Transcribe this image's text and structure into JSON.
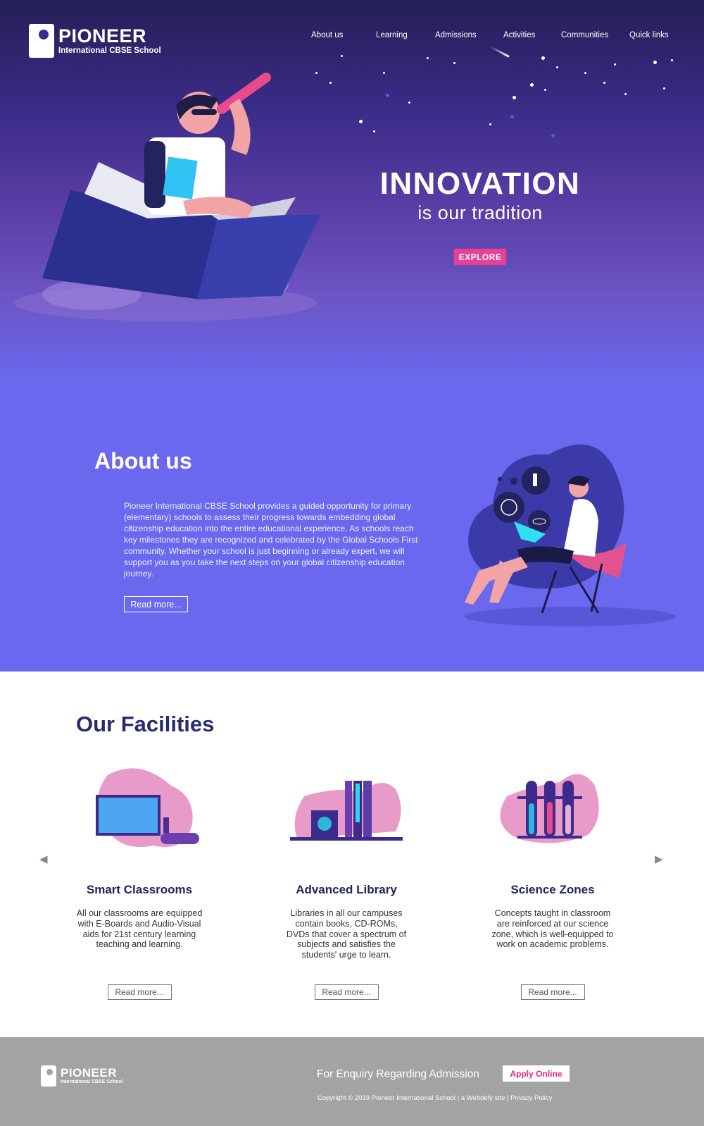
{
  "brand": {
    "name": "PIONEER",
    "subtitle": "International CBSE School"
  },
  "nav": {
    "items": [
      {
        "label": "About us"
      },
      {
        "label": "Learning"
      },
      {
        "label": "Admissions"
      },
      {
        "label": "Activities"
      },
      {
        "label": "Communities"
      },
      {
        "label": "Quick links"
      }
    ]
  },
  "hero": {
    "title": "INNOVATION",
    "subtitle": "is our tradition",
    "cta_label": "EXPLORE"
  },
  "about": {
    "title": "About us",
    "body": "Pioneer International CBSE School provides a guided opportunity for primary (elementary) schools to assess their progress towards embedding global citizenship education into the entire educational experience. As schools reach key milestones they are recognized and celebrated by the Global Schools First community. Whether your school is just beginning or already expert, we will support you as you take the next steps on your global citizenship education journey.",
    "read_more": "Read more..."
  },
  "facilities": {
    "title": "Our Facilities",
    "prev_icon": "◀",
    "next_icon": "▶",
    "cards": [
      {
        "title": "Smart Classrooms",
        "text": "All our classrooms are equipped with E-Boards and Audio-Visual aids for 21st century learning teaching and learning.",
        "read_more": "Read more...",
        "icon": "smart-board-icon"
      },
      {
        "title": "Advanced Library",
        "text": "Libraries in all our campuses contain books, CD-ROMs, DVDs that cover a spectrum of subjects and satisfies the students' urge to learn.",
        "read_more": "Read more...",
        "icon": "library-books-icon"
      },
      {
        "title": "Science Zones",
        "text": "Concepts taught in classroom are reinforced at our science zone, which is well-equipped to work on academic problems.",
        "read_more": "Read more...",
        "icon": "test-tubes-icon"
      }
    ]
  },
  "footer": {
    "enquiry": "For Enquiry Regarding Admission",
    "apply_label": "Apply Online",
    "copyright": "Copyright © 2019 Pioneer International School | a Webdefy site | Privacy Policy"
  },
  "colors": {
    "hero_top": "#241f57",
    "about_bg": "#6a68ef",
    "accent_pink": "#e93f95",
    "heading_navy": "#2a2b6e",
    "footer_bg": "#a3a3a3"
  }
}
